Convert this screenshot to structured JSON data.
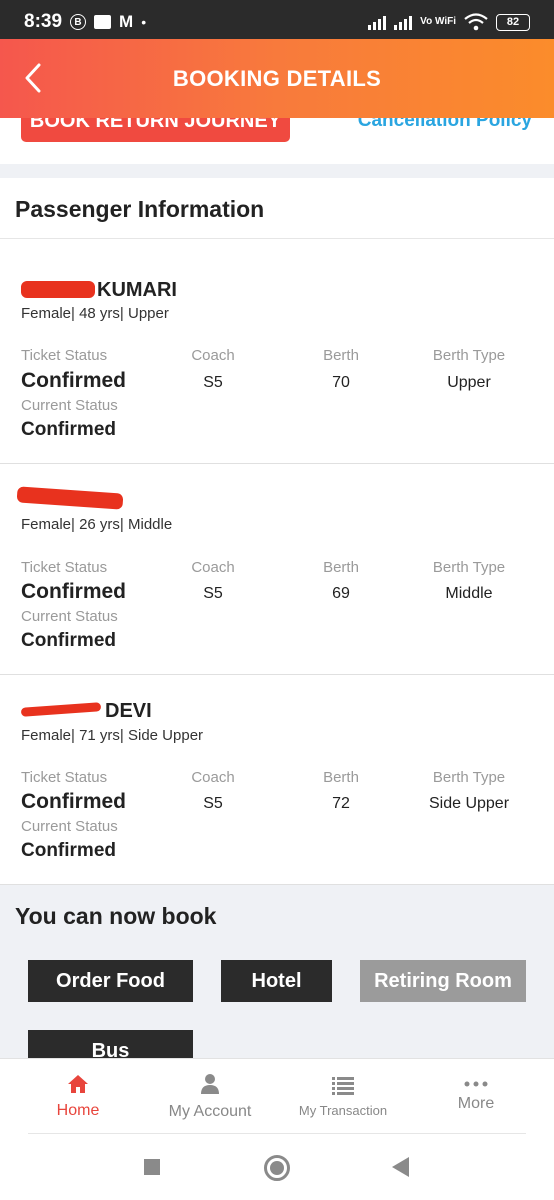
{
  "status_bar": {
    "time": "8:39",
    "icons": [
      "b-circle-icon",
      "message-icon",
      "gmail-icon",
      "dot-icon"
    ],
    "network": "Vo WiFi",
    "battery": "82"
  },
  "header": {
    "title": "BOOKING DETAILS",
    "back_icon": "chevron-left-icon"
  },
  "top_actions": {
    "return_button": "BOOK RETURN JOURNEY",
    "cancellation_link": "Cancellation Policy"
  },
  "section_title": "Passenger Information",
  "labels": {
    "ticket_status": "Ticket Status",
    "coach": "Coach",
    "berth": "Berth",
    "berth_type": "Berth Type",
    "current_status": "Current Status"
  },
  "passengers": [
    {
      "name": "KUMARI",
      "details": "Female| 48 yrs| Upper",
      "ticket_status": "Confirmed",
      "coach": "S5",
      "berth": "70",
      "berth_type": "Upper",
      "current_status": "Confirmed"
    },
    {
      "name": "",
      "details": "Female| 26 yrs| Middle",
      "ticket_status": "Confirmed",
      "coach": "S5",
      "berth": "69",
      "berth_type": "Middle",
      "current_status": "Confirmed"
    },
    {
      "name": "DEVI",
      "details": "Female| 71 yrs| Side Upper",
      "ticket_status": "Confirmed",
      "coach": "S5",
      "berth": "72",
      "berth_type": "Side Upper",
      "current_status": "Confirmed"
    }
  ],
  "book_section": {
    "title": "You can now book",
    "buttons": [
      "Order Food",
      "Hotel",
      "Retiring Room",
      "Bus"
    ]
  },
  "bottom_nav": [
    {
      "label": "Home",
      "icon": "home-icon",
      "active": true
    },
    {
      "label": "My Account",
      "icon": "person-icon",
      "active": false
    },
    {
      "label": "My Transaction",
      "icon": "list-icon",
      "active": false
    },
    {
      "label": "More",
      "icon": "more-dots-icon",
      "active": false
    }
  ],
  "colors": {
    "accent_red": "#e8453c",
    "header_gradient_start": "#f5574d",
    "header_gradient_end": "#fb8c2b",
    "link_blue": "#2aa5e0",
    "dark_button": "#2b2b2b",
    "disabled_button": "#9b9b9b"
  }
}
